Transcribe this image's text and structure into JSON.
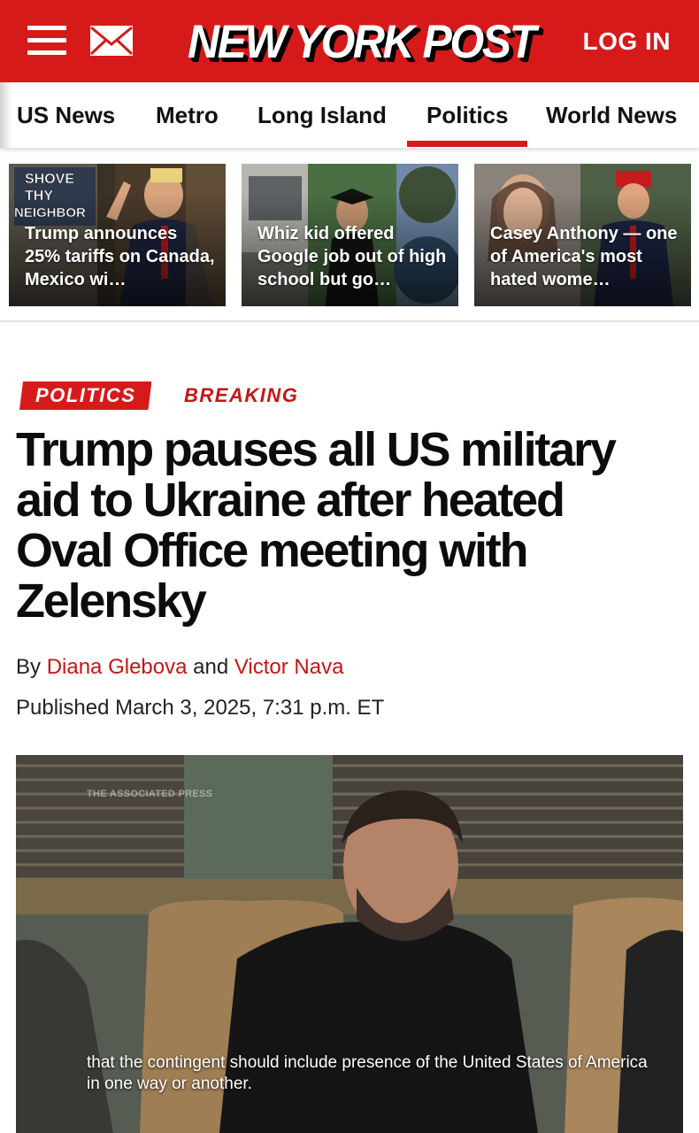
{
  "header": {
    "logo": "NEW YORK POST",
    "login_label": "LOG IN",
    "brand_color": "#d61a1a",
    "menu_icon": "hamburger-menu-icon",
    "mail_icon": "mail-icon"
  },
  "nav": {
    "items": [
      {
        "label": "US News"
      },
      {
        "label": "Metro"
      },
      {
        "label": "Long Island"
      },
      {
        "label": "Politics",
        "active": true
      },
      {
        "label": "World News"
      }
    ]
  },
  "trending": [
    {
      "caption": "Trump announces 25% tariffs on Canada, Mexico wi…",
      "image_text": "SHOVE THY NEIGHBOR"
    },
    {
      "caption": "Whiz kid offered Google job out of high school but go…"
    },
    {
      "caption": "Casey Anthony — one of America's most hated wome…"
    }
  ],
  "article": {
    "section_tag": "POLITICS",
    "breaking_tag": "BREAKING",
    "headline": "Trump pauses all US military aid to Ukraine after heated Oval Office meeting with Zelensky",
    "byline_prefix": "By",
    "author1": "Diana Glebova",
    "byline_joiner": "and",
    "author2": "Victor Nava",
    "published": "Published March 3, 2025, 7:31 p.m. ET"
  },
  "video": {
    "watermark": "THE ASSOCIATED PRESS",
    "subtitle": "that the contingent should include presence of the United States of America in one way or another."
  }
}
